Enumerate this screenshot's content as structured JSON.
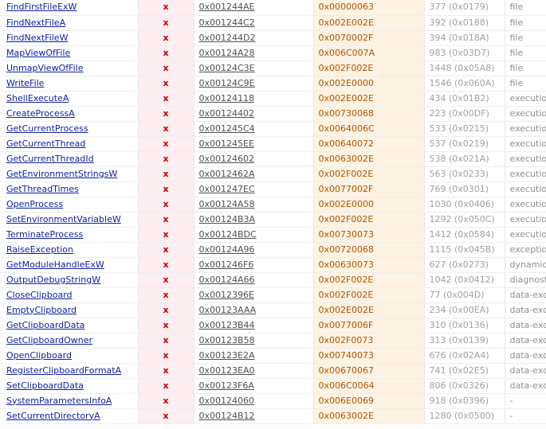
{
  "colors": {
    "link": "#1020a0",
    "flag_bg": "#fdeef1",
    "flag_mark": "#c00000",
    "value_bg": "#fef2e3",
    "value_text": "#b05500",
    "ordinal_text": "#a0a0a0",
    "group_text": "#909090"
  },
  "rows": [
    {
      "name": "FindFirstFileExW",
      "flag": "x",
      "address": "0x001244AE",
      "value": "0x00000063",
      "ordinal": "377 (0x0179)",
      "group": "file"
    },
    {
      "name": "FindNextFileA",
      "flag": "x",
      "address": "0x001244C2",
      "value": "0x002E002E",
      "ordinal": "392 (0x0188)",
      "group": "file"
    },
    {
      "name": "FindNextFileW",
      "flag": "x",
      "address": "0x001244D2",
      "value": "0x0070002F",
      "ordinal": "394 (0x018A)",
      "group": "file"
    },
    {
      "name": "MapViewOfFile",
      "flag": "x",
      "address": "0x00124A28",
      "value": "0x006C007A",
      "ordinal": "983 (0x03D7)",
      "group": "file"
    },
    {
      "name": "UnmapViewOfFile",
      "flag": "x",
      "address": "0x00124C3E",
      "value": "0x002F002E",
      "ordinal": "1448 (0x05A8)",
      "group": "file"
    },
    {
      "name": "WriteFile",
      "flag": "x",
      "address": "0x00124C9E",
      "value": "0x002E0000",
      "ordinal": "1546 (0x060A)",
      "group": "file"
    },
    {
      "name": "ShellExecuteA",
      "flag": "x",
      "address": "0x00124118",
      "value": "0x002E002E",
      "ordinal": "434 (0x01B2)",
      "group": "executio"
    },
    {
      "name": "CreateProcessA",
      "flag": "x",
      "address": "0x00124402",
      "value": "0x00730068",
      "ordinal": "223 (0x00DF)",
      "group": "executio"
    },
    {
      "name": "GetCurrentProcess",
      "flag": "x",
      "address": "0x001245C4",
      "value": "0x0064006C",
      "ordinal": "533 (0x0215)",
      "group": "executio"
    },
    {
      "name": "GetCurrentThread",
      "flag": "x",
      "address": "0x001245EE",
      "value": "0x00640072",
      "ordinal": "537 (0x0219)",
      "group": "executio"
    },
    {
      "name": "GetCurrentThreadId",
      "flag": "x",
      "address": "0x00124602",
      "value": "0x0063002E",
      "ordinal": "538 (0x021A)",
      "group": "executio"
    },
    {
      "name": "GetEnvironmentStringsW",
      "flag": "x",
      "address": "0x0012462A",
      "value": "0x002F002E",
      "ordinal": "563 (0x0233)",
      "group": "executio"
    },
    {
      "name": "GetThreadTimes",
      "flag": "x",
      "address": "0x001247EC",
      "value": "0x0077002F",
      "ordinal": "769 (0x0301)",
      "group": "executio"
    },
    {
      "name": "OpenProcess",
      "flag": "x",
      "address": "0x00124A58",
      "value": "0x002E0000",
      "ordinal": "1030 (0x0406)",
      "group": "executio"
    },
    {
      "name": "SetEnvironmentVariableW",
      "flag": "x",
      "address": "0x00124B3A",
      "value": "0x002F002E",
      "ordinal": "1292 (0x050C)",
      "group": "executio"
    },
    {
      "name": "TerminateProcess",
      "flag": "x",
      "address": "0x00124BDC",
      "value": "0x00730073",
      "ordinal": "1412 (0x0584)",
      "group": "executio"
    },
    {
      "name": "RaiseException",
      "flag": "x",
      "address": "0x00124A96",
      "value": "0x00720068",
      "ordinal": "1115 (0x045B)",
      "group": "exceptio"
    },
    {
      "name": "GetModuleHandleExW",
      "flag": "x",
      "address": "0x001246F6",
      "value": "0x00630073",
      "ordinal": "627 (0x0273)",
      "group": "dynamic"
    },
    {
      "name": "OutputDebugStringW",
      "flag": "x",
      "address": "0x00124A66",
      "value": "0x002F002E",
      "ordinal": "1042 (0x0412)",
      "group": "diagnost"
    },
    {
      "name": "CloseClipboard",
      "flag": "x",
      "address": "0x0012396E",
      "value": "0x002F002E",
      "ordinal": "77 (0x004D)",
      "group": "data-exc"
    },
    {
      "name": "EmptyClipboard",
      "flag": "x",
      "address": "0x00123AAA",
      "value": "0x002E002E",
      "ordinal": "234 (0x00EA)",
      "group": "data-exc"
    },
    {
      "name": "GetClipboardData",
      "flag": "x",
      "address": "0x00123B44",
      "value": "0x0077006F",
      "ordinal": "310 (0x0136)",
      "group": "data-exc"
    },
    {
      "name": "GetClipboardOwner",
      "flag": "x",
      "address": "0x00123B58",
      "value": "0x002F0073",
      "ordinal": "313 (0x0139)",
      "group": "data-exc"
    },
    {
      "name": "OpenClipboard",
      "flag": "x",
      "address": "0x00123E2A",
      "value": "0x00740073",
      "ordinal": "676 (0x02A4)",
      "group": "data-exc"
    },
    {
      "name": "RegisterClipboardFormatA",
      "flag": "x",
      "address": "0x00123EA0",
      "value": "0x00670067",
      "ordinal": "741 (0x02E5)",
      "group": "data-exc"
    },
    {
      "name": "SetClipboardData",
      "flag": "x",
      "address": "0x00123F6A",
      "value": "0x006C0064",
      "ordinal": "806 (0x0326)",
      "group": "data-exc"
    },
    {
      "name": "SystemParametersInfoA",
      "flag": "x",
      "address": "0x00124060",
      "value": "0x006E0069",
      "ordinal": "918 (0x0396)",
      "group": "-"
    },
    {
      "name": "SetCurrentDirectoryA",
      "flag": "x",
      "address": "0x00124B12",
      "value": "0x0063002E",
      "ordinal": "1280 (0x0500)",
      "group": "-"
    }
  ]
}
